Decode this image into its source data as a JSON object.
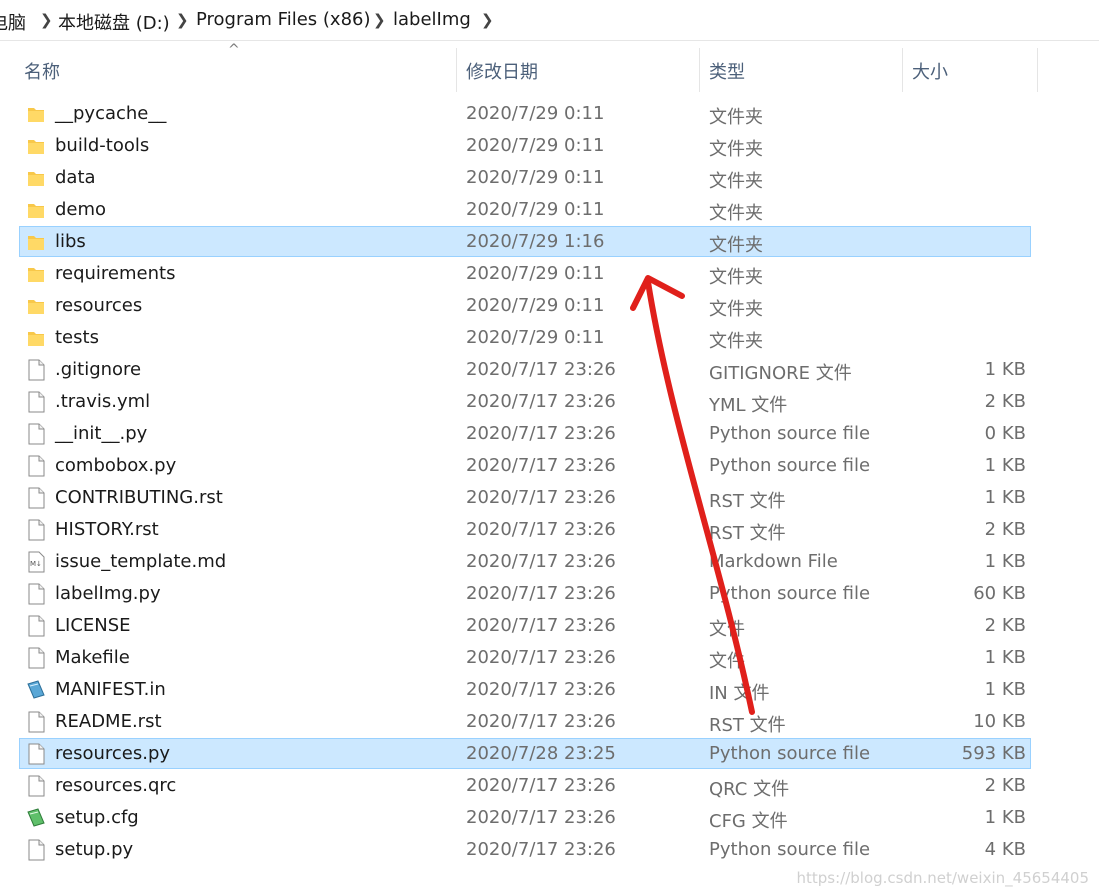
{
  "breadcrumb": {
    "items": [
      "电脑",
      "本地磁盘 (D:)",
      "Program Files (x86)",
      "labelImg"
    ]
  },
  "columns": {
    "name": "名称",
    "date": "修改日期",
    "type": "类型",
    "size": "大小",
    "sort_indicator": "^"
  },
  "files": [
    {
      "name": "__pycache__",
      "date": "2020/7/29 0:11",
      "type": "文件夹",
      "size": "",
      "icon": "folder-icon"
    },
    {
      "name": "build-tools",
      "date": "2020/7/29 0:11",
      "type": "文件夹",
      "size": "",
      "icon": "folder-icon"
    },
    {
      "name": "data",
      "date": "2020/7/29 0:11",
      "type": "文件夹",
      "size": "",
      "icon": "folder-icon"
    },
    {
      "name": "demo",
      "date": "2020/7/29 0:11",
      "type": "文件夹",
      "size": "",
      "icon": "folder-icon"
    },
    {
      "name": "libs",
      "date": "2020/7/29 1:16",
      "type": "文件夹",
      "size": "",
      "icon": "folder-icon",
      "selected": true
    },
    {
      "name": "requirements",
      "date": "2020/7/29 0:11",
      "type": "文件夹",
      "size": "",
      "icon": "folder-icon"
    },
    {
      "name": "resources",
      "date": "2020/7/29 0:11",
      "type": "文件夹",
      "size": "",
      "icon": "folder-icon"
    },
    {
      "name": "tests",
      "date": "2020/7/29 0:11",
      "type": "文件夹",
      "size": "",
      "icon": "folder-icon"
    },
    {
      "name": ".gitignore",
      "date": "2020/7/17 23:26",
      "type": "GITIGNORE 文件",
      "size": "1 KB",
      "icon": "file-icon"
    },
    {
      "name": ".travis.yml",
      "date": "2020/7/17 23:26",
      "type": "YML 文件",
      "size": "2 KB",
      "icon": "file-icon"
    },
    {
      "name": "__init__.py",
      "date": "2020/7/17 23:26",
      "type": "Python source file",
      "size": "0 KB",
      "icon": "file-icon"
    },
    {
      "name": "combobox.py",
      "date": "2020/7/17 23:26",
      "type": "Python source file",
      "size": "1 KB",
      "icon": "file-icon"
    },
    {
      "name": "CONTRIBUTING.rst",
      "date": "2020/7/17 23:26",
      "type": "RST 文件",
      "size": "1 KB",
      "icon": "file-icon"
    },
    {
      "name": "HISTORY.rst",
      "date": "2020/7/17 23:26",
      "type": "RST 文件",
      "size": "2 KB",
      "icon": "file-icon"
    },
    {
      "name": "issue_template.md",
      "date": "2020/7/17 23:26",
      "type": "Markdown File",
      "size": "1 KB",
      "icon": "markdown-file-icon"
    },
    {
      "name": "labelImg.py",
      "date": "2020/7/17 23:26",
      "type": "Python source file",
      "size": "60 KB",
      "icon": "file-icon"
    },
    {
      "name": "LICENSE",
      "date": "2020/7/17 23:26",
      "type": "文件",
      "size": "2 KB",
      "icon": "file-icon"
    },
    {
      "name": "Makefile",
      "date": "2020/7/17 23:26",
      "type": "文件",
      "size": "1 KB",
      "icon": "file-icon"
    },
    {
      "name": "MANIFEST.in",
      "date": "2020/7/17 23:26",
      "type": "IN 文件",
      "size": "1 KB",
      "icon": "manifest-file-icon"
    },
    {
      "name": "README.rst",
      "date": "2020/7/17 23:26",
      "type": "RST 文件",
      "size": "10 KB",
      "icon": "file-icon"
    },
    {
      "name": "resources.py",
      "date": "2020/7/28 23:25",
      "type": "Python source file",
      "size": "593 KB",
      "icon": "file-icon",
      "selected": true
    },
    {
      "name": "resources.qrc",
      "date": "2020/7/17 23:26",
      "type": "QRC 文件",
      "size": "2 KB",
      "icon": "file-icon"
    },
    {
      "name": "setup.cfg",
      "date": "2020/7/17 23:26",
      "type": "CFG 文件",
      "size": "1 KB",
      "icon": "config-file-icon"
    },
    {
      "name": "setup.py",
      "date": "2020/7/17 23:26",
      "type": "Python source file",
      "size": "4 KB",
      "icon": "file-icon"
    }
  ],
  "watermark": "https://blog.csdn.net/weixin_45654405",
  "colors": {
    "selection_bg": "#cce8ff",
    "selection_border": "#99d1ff",
    "folder": "#f8c84a",
    "annotation_arrow": "#e0201b"
  }
}
